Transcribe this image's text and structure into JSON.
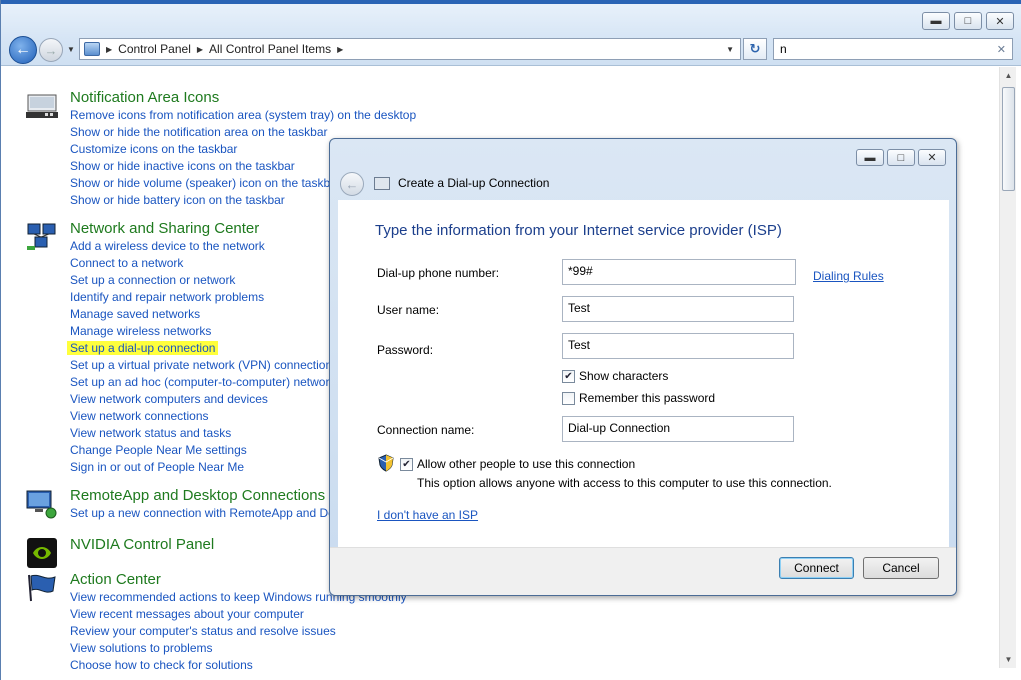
{
  "explorer": {
    "breadcrumb": [
      "Control Panel",
      "All Control Panel Items"
    ],
    "search_value": "n"
  },
  "categories": [
    {
      "title": "Notification Area Icons",
      "links": [
        "Remove icons from notification area (system tray) on the desktop",
        "Show or hide the notification area on the taskbar",
        "Customize icons on the taskbar",
        "Show or hide inactive icons on the taskbar",
        "Show or hide volume (speaker) icon on the taskbar",
        "Show or hide battery icon on the taskbar"
      ]
    },
    {
      "title": "Network and Sharing Center",
      "links": [
        "Add a wireless device to the network",
        "Connect to a network",
        "Set up a connection or network",
        "Identify and repair network problems",
        "Manage saved networks",
        "Manage wireless networks",
        "Set up a dial-up connection",
        "Set up a virtual private network (VPN) connection",
        "Set up an ad hoc (computer-to-computer) network",
        "View network computers and devices",
        "View network connections",
        "View network status and tasks",
        "Change People Near Me settings",
        "Sign in or out of People Near Me"
      ],
      "highlighted_link": "Set up a dial-up connection"
    },
    {
      "title": "RemoteApp and Desktop Connections",
      "links": [
        "Set up a new connection with RemoteApp and Desktop Connections"
      ]
    },
    {
      "title": "NVIDIA Control Panel",
      "links": []
    },
    {
      "title": "Action Center",
      "links": [
        "View recommended actions to keep Windows running smoothly",
        "View recent messages about your computer",
        "Review your computer's status and resolve issues",
        "View solutions to problems",
        "Choose how to check for solutions"
      ]
    }
  ],
  "dialog": {
    "title": "Create a Dial-up Connection",
    "heading": "Type the information from your Internet service provider (ISP)",
    "phone_label": "Dial-up phone number:",
    "phone_value": "*99#",
    "dialing_rules": "Dialing Rules",
    "username_label": "User name:",
    "username_value": "Test",
    "password_label": "Password:",
    "password_value": "Test",
    "show_chars_label": "Show characters",
    "show_chars_checked": true,
    "remember_label": "Remember this password",
    "remember_checked": false,
    "connname_label": "Connection name:",
    "connname_value": "Dial-up Connection",
    "allow_label": "Allow other people to use this connection",
    "allow_checked": true,
    "allow_desc": "This option allows anyone with access to this computer to use this connection.",
    "no_isp_link": "I don't have an ISP",
    "connect_label": "Connect",
    "cancel_label": "Cancel"
  }
}
